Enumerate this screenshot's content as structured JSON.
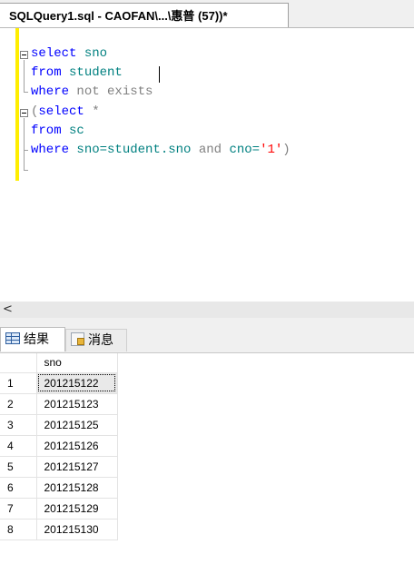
{
  "window": {
    "doc_tab_title": "SQLQuery1.sql - CAOFAN\\...\\惠普 (57))*"
  },
  "editor": {
    "lines": [
      [
        {
          "t": "select",
          "c": "kw"
        },
        {
          "t": " sno",
          "c": "plain"
        }
      ],
      [
        {
          "t": "from",
          "c": "kw"
        },
        {
          "t": " student",
          "c": "plain"
        }
      ],
      [
        {
          "t": "where",
          "c": "kw"
        },
        {
          "t": " not exists",
          "c": "gray"
        }
      ],
      [
        {
          "t": "(",
          "c": "gray"
        },
        {
          "t": "select",
          "c": "kw"
        },
        {
          "t": " *",
          "c": "gray"
        }
      ],
      [
        {
          "t": "from",
          "c": "kw"
        },
        {
          "t": " sc",
          "c": "plain"
        }
      ],
      [
        {
          "t": "where",
          "c": "kw"
        },
        {
          "t": " sno=student.sno ",
          "c": "plain"
        },
        {
          "t": "and",
          "c": "gray"
        },
        {
          "t": " cno=",
          "c": "plain"
        },
        {
          "t": "'1'",
          "c": "red"
        },
        {
          "t": ")",
          "c": "gray"
        }
      ]
    ],
    "colors": {
      "kw": "#0000ff",
      "gray": "#808080",
      "red": "#ff0000",
      "plain": "#008080",
      "change_bar": "#ffee00"
    }
  },
  "scrollbar": {
    "left_arrow": "<"
  },
  "result_tabs": {
    "results_label": "结果",
    "messages_label": "消息",
    "results_icon": "results-grid-icon",
    "messages_icon": "messages-icon"
  },
  "results": {
    "columns": [
      "sno"
    ],
    "rows": [
      {
        "n": "1",
        "sno": "201215122"
      },
      {
        "n": "2",
        "sno": "201215123"
      },
      {
        "n": "3",
        "sno": "201215125"
      },
      {
        "n": "4",
        "sno": "201215126"
      },
      {
        "n": "5",
        "sno": "201215127"
      },
      {
        "n": "6",
        "sno": "201215128"
      },
      {
        "n": "7",
        "sno": "201215129"
      },
      {
        "n": "8",
        "sno": "201215130"
      }
    ]
  }
}
